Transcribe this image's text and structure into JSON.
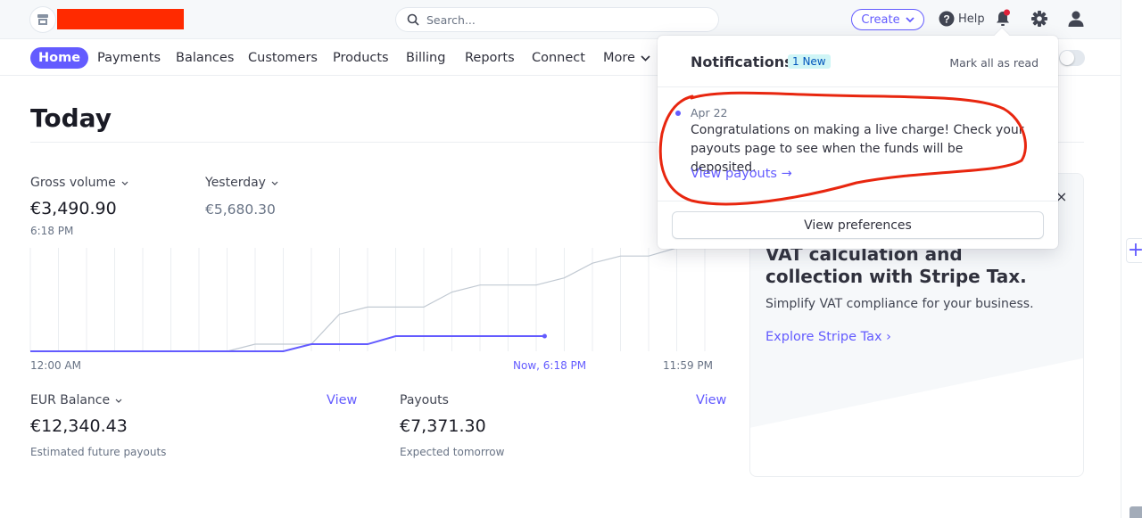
{
  "topbar": {
    "account_name_redacted": true,
    "search_placeholder": "Search...",
    "create_label": "Create",
    "help_label": "Help",
    "notification_unread": true
  },
  "nav": {
    "items": [
      {
        "label": "Home",
        "active": true
      },
      {
        "label": "Payments"
      },
      {
        "label": "Balances"
      },
      {
        "label": "Customers"
      },
      {
        "label": "Products"
      },
      {
        "label": "Billing"
      },
      {
        "label": "Reports"
      },
      {
        "label": "Connect"
      },
      {
        "label": "More"
      }
    ],
    "test_mode_toggle_on": false
  },
  "today": {
    "title": "Today",
    "gross_volume_label": "Gross volume",
    "gross_volume_value": "€3,490.90",
    "gross_volume_time": "6:18 PM",
    "compare_label": "Yesterday",
    "compare_value": "€5,680.30"
  },
  "chart_data": {
    "type": "line",
    "title": "Gross volume",
    "x": [
      0,
      1,
      2,
      3,
      4,
      5,
      6,
      7,
      8,
      9,
      10,
      11,
      12,
      13,
      14,
      15,
      16,
      17,
      18,
      19,
      20,
      21,
      22,
      23,
      24
    ],
    "x_tick_labels": [
      "12:00 AM",
      "Now, 6:18 PM",
      "11:59 PM"
    ],
    "xlabel": "",
    "ylabel": "",
    "grid": "vertical",
    "series": [
      {
        "name": "Yesterday",
        "color": "#c1c9d2",
        "values": [
          0,
          0,
          0,
          0,
          0,
          0,
          0,
          0,
          390,
          390,
          390,
          2040,
          2430,
          2430,
          2430,
          3250,
          3640,
          3640,
          3640,
          4030,
          4840,
          5230,
          5230,
          5680.3,
          5680.3
        ]
      },
      {
        "name": "Today",
        "color": "#635bff",
        "x": [
          0,
          1,
          2,
          3,
          4,
          5,
          6,
          7,
          8,
          9,
          10,
          11,
          12,
          13,
          14,
          15,
          16,
          17,
          18.3
        ],
        "values": [
          0,
          0,
          0,
          0,
          0,
          0,
          0,
          0,
          0,
          0,
          390,
          390,
          390,
          830,
          830,
          830,
          830,
          830,
          830
        ]
      }
    ],
    "ylim": [
      0,
      5680.3
    ]
  },
  "balance": {
    "label": "EUR Balance",
    "value": "€12,340.43",
    "sub": "Estimated future payouts",
    "view_label": "View"
  },
  "payouts": {
    "label": "Payouts",
    "value": "€7,371.30",
    "sub": "Expected tomorrow",
    "view_label": "View"
  },
  "promo": {
    "title": "VAT calculation and collection with Stripe Tax.",
    "text": "Simplify VAT compliance for your business.",
    "link_label": "Explore Stripe Tax",
    "link_chevron": "›",
    "close_label": "×"
  },
  "notifications": {
    "title": "Notifications",
    "badge": "1 New",
    "mark_all_label": "Mark all as read",
    "items": [
      {
        "date": "Apr 22",
        "unread": true,
        "body": "Congratulations on making a live charge! Check your payouts page to see when the funds will be deposited.",
        "link_label": "View payouts →"
      }
    ],
    "preferences_label": "View preferences"
  },
  "annotation": {
    "color": "#e8260f",
    "description": "red hand-drawn circle around notification item"
  },
  "colors": {
    "accent": "#635bff",
    "redaction": "#ff2a00",
    "bell_dot": "#e0213a"
  }
}
